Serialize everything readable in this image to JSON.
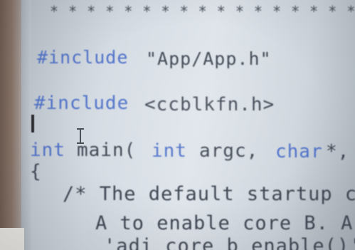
{
  "editor": {
    "lines": {
      "stars": "* * * * * * * * * * * * * * * * * * *",
      "include1_kw": "#include",
      "include1_arg": "\"App/App.h\"",
      "include2_kw": "#include",
      "include2_arg": "<ccblkfn.h>",
      "main_kw1": "int",
      "main_name": "main(",
      "main_kw2": "int",
      "main_argc": "argc,",
      "main_kw3": "char",
      "main_tail": "*,",
      "brace": "{",
      "comment1": "/* The default startup c",
      "comment2": "A to enable core B. A",
      "comment3": "'adi_core_b_enable()'"
    }
  }
}
